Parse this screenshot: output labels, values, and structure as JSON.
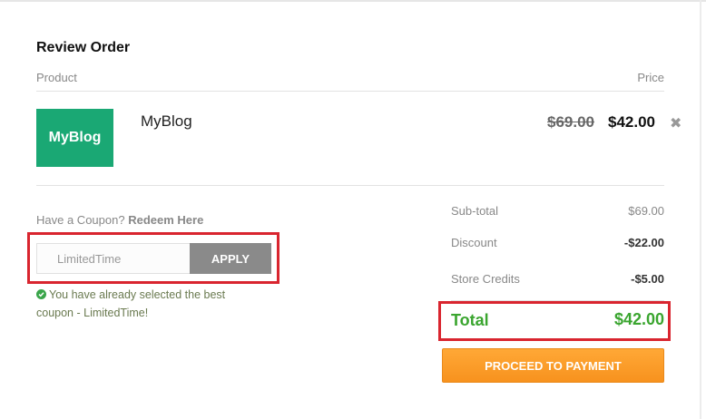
{
  "review": {
    "title": "Review Order",
    "col_product": "Product",
    "col_price": "Price"
  },
  "item": {
    "logo_text": "MyBlog",
    "name": "MyBlog",
    "price_original": "$69.00",
    "price_current": "$42.00",
    "remove_icon": "close-icon"
  },
  "coupon": {
    "question": "Have a Coupon?",
    "redeem_link": "Redeem Here",
    "value": "LimitedTime",
    "apply_label": "APPLY",
    "message": "You have already selected the best coupon - LimitedTime!"
  },
  "summary": {
    "subtotal_label": "Sub-total",
    "subtotal_value": "$69.00",
    "discount_label": "Discount",
    "discount_value": "-$22.00",
    "credits_label": "Store Credits",
    "credits_value": "-$5.00",
    "total_label": "Total",
    "total_value": "$42.00"
  },
  "actions": {
    "proceed_label": "PROCEED TO PAYMENT"
  },
  "colors": {
    "logo_bg": "#1aa874",
    "total_green": "#3aa52f",
    "highlight_red": "#d9252f",
    "pay_orange": "#f7921e",
    "apply_gray": "#8a8a8a"
  }
}
